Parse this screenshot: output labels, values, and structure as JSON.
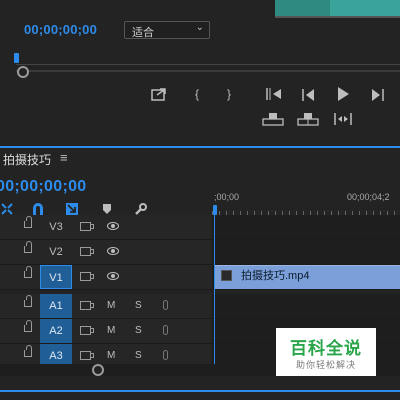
{
  "monitor": {
    "timecode": "00;00;00;00",
    "fit_value": "适合"
  },
  "timeline": {
    "sequence_name": "拍摄技巧",
    "timecode": "00;00;00;00",
    "ruler_start": ";00;00",
    "ruler_end": "00;00;04;2"
  },
  "tracks": [
    {
      "label": "V3"
    },
    {
      "label": "V2"
    },
    {
      "label": "V1"
    },
    {
      "label": "A1",
      "m": "M",
      "s": "S"
    },
    {
      "label": "A2",
      "m": "M",
      "s": "S"
    },
    {
      "label": "A3",
      "m": "M",
      "s": "S"
    }
  ],
  "clip": {
    "name": "拍摄技巧.mp4"
  },
  "watermark": {
    "title": "百科全说",
    "subtitle": "助你轻松解决"
  },
  "colors": {
    "accent": "#2d8ceb",
    "clip": "#7b9fd8",
    "ruler_marker": "#d4c23b"
  }
}
